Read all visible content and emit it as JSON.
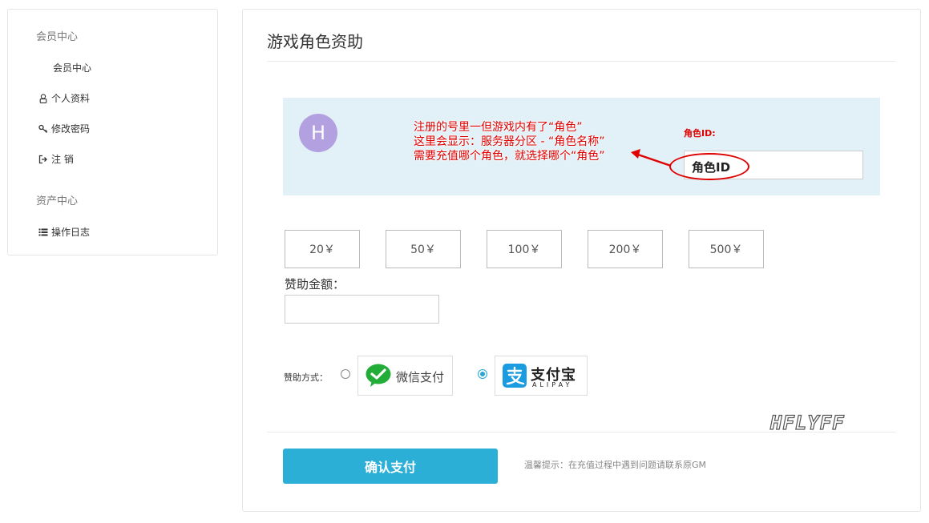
{
  "sidebar": {
    "member_heading": "会员中心",
    "items": [
      {
        "label": "会员中心"
      },
      {
        "label": "个人资料"
      },
      {
        "label": "修改密码"
      },
      {
        "label": "注 销"
      }
    ],
    "asset_heading": "资产中心",
    "asset_items": [
      {
        "label": "操作日志"
      }
    ]
  },
  "main": {
    "title": "游戏角色资助",
    "role_panel": {
      "avatar_letter": "H",
      "note_lines": [
        "注册的号里一但游戏内有了“角色”",
        "这里会显示：服务器分区 - “角色名称”",
        "需要充值哪个角色，就选择哪个“角色”"
      ],
      "role_label": "角色ID:",
      "role_input_value": "角色ID"
    },
    "amounts": [
      "20￥",
      "50￥",
      "100￥",
      "200￥",
      "500￥"
    ],
    "amount_label": "赞助金额：",
    "amount_input_value": "",
    "payment": {
      "label": "赞助方式：",
      "wechat_label": "微信支付",
      "wechat_selected": false,
      "alipay_label": "支付宝",
      "alipay_sub": "ALIPAY",
      "alipay_selected": true
    },
    "watermark": "HFLYFF",
    "confirm_label": "确认支付",
    "tip": "温馨提示：在充值过程中遇到问题请联系原GM"
  },
  "colors": {
    "accent": "#2bafd7",
    "panel_bg": "#e1f1f7",
    "annotation_red": "#e00000",
    "avatar_bg": "#b3a0e0",
    "wechat_green": "#22ac38",
    "alipay_blue": "#1b9ce0"
  }
}
